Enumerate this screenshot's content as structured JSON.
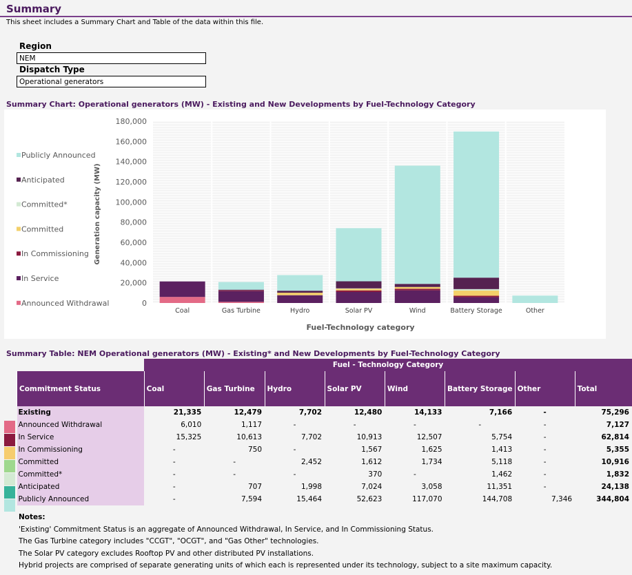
{
  "page": {
    "title": "Summary",
    "subtitle": "This sheet includes a Summary Chart and Table of the data within this file."
  },
  "filters": {
    "region_label": "Region",
    "region_value": "NEM",
    "dispatch_label": "Dispatch Type",
    "dispatch_value": "Operational generators"
  },
  "chart_section_title": "Summary Chart:  Operational generators (MW) - Existing and New Developments by Fuel-Technology Category",
  "table_section_title": "Summary Table:  NEM Operational generators (MW) - Existing* and New Developments by Fuel-Technology Category",
  "colors": {
    "Announced Withdrawal": "#e36a86",
    "In Service": "#5b2160",
    "In Commissioning": "#8b1a3f",
    "Committed": "#f3d06a",
    "Committed*": "#d3ead3",
    "Anticipated": "#552250",
    "Publicly Announced": "#b2e6e0"
  },
  "chart_data": {
    "type": "bar",
    "stacked": true,
    "categories": [
      "Coal",
      "Gas Turbine",
      "Hydro",
      "Solar PV",
      "Wind",
      "Battery Storage",
      "Other"
    ],
    "series": [
      {
        "name": "Announced Withdrawal",
        "values": [
          6010,
          1117,
          0,
          0,
          0,
          0,
          0
        ]
      },
      {
        "name": "In Service",
        "values": [
          15325,
          10613,
          7702,
          10913,
          12507,
          5754,
          0
        ]
      },
      {
        "name": "In Commissioning",
        "values": [
          0,
          750,
          0,
          1567,
          1625,
          1413,
          0
        ]
      },
      {
        "name": "Committed",
        "values": [
          0,
          0,
          2452,
          1612,
          1734,
          5118,
          0
        ]
      },
      {
        "name": "Committed*",
        "values": [
          0,
          0,
          0,
          370,
          0,
          1462,
          0
        ]
      },
      {
        "name": "Anticipated",
        "values": [
          0,
          707,
          1998,
          7024,
          3058,
          11351,
          0
        ]
      },
      {
        "name": "Publicly Announced",
        "values": [
          0,
          7594,
          15464,
          52623,
          117070,
          144708,
          7346
        ]
      }
    ],
    "legend_order": [
      "Publicly Announced",
      "Anticipated",
      "Committed*",
      "Committed",
      "In Commissioning",
      "In Service",
      "Announced Withdrawal"
    ],
    "xlabel": "Fuel-Technology category",
    "ylabel": "Generation capacity (MW)",
    "ylim": [
      0,
      180000
    ],
    "yticks": [
      "180,000",
      "160,000",
      "140,000",
      "120,000",
      "100,000",
      "80,000",
      "60,000",
      "40,000",
      "20,000",
      "0"
    ],
    "grid": true,
    "legend_position": "left"
  },
  "table": {
    "group_header": "Fuel - Technology Category",
    "columns": [
      "Commitment Status",
      "Coal",
      "Gas Turbine",
      "Hydro",
      "Solar PV",
      "Wind",
      "Battery Storage",
      "Other",
      "Total"
    ],
    "rows": [
      {
        "status": "Existing",
        "bold": true,
        "cells": [
          "21,335",
          "12,479",
          "7,702",
          "12,480",
          "14,133",
          "7,166",
          "-",
          "75,296"
        ]
      },
      {
        "status": "Announced Withdrawal",
        "color": "#e36a86",
        "cells": [
          "6,010",
          "1,117",
          "-",
          "-",
          "-",
          "-",
          "-",
          "7,127"
        ]
      },
      {
        "status": "In Service",
        "color": "#8b1a3f",
        "cells": [
          "15,325",
          "10,613",
          "7,702",
          "10,913",
          "12,507",
          "5,754",
          "-",
          "62,814"
        ]
      },
      {
        "status": "In Commissioning",
        "color": "#f6cd6e",
        "cells": [
          "-",
          "750",
          "-",
          "1,567",
          "1,625",
          "1,413",
          "-",
          "5,355"
        ]
      },
      {
        "status": "Committed",
        "color": "#9fd88e",
        "cells": [
          "-",
          "-",
          "2,452",
          "1,612",
          "1,734",
          "5,118",
          "-",
          "10,916"
        ]
      },
      {
        "status": "Committed*",
        "color": "#d3ead3",
        "cells": [
          "-",
          "-",
          "-",
          "370",
          "-",
          "1,462",
          "-",
          "1,832"
        ]
      },
      {
        "status": "Anticipated",
        "color": "#37b39a",
        "cells": [
          "-",
          "707",
          "1,998",
          "7,024",
          "3,058",
          "11,351",
          "-",
          "24,138"
        ]
      },
      {
        "status": "Publicly Announced",
        "color": "#b2e6e0",
        "cells": [
          "-",
          "7,594",
          "15,464",
          "52,623",
          "117,070",
          "144,708",
          "7,346",
          "344,804"
        ]
      }
    ]
  },
  "notes": {
    "title": "Notes:",
    "lines": [
      "'Existing' Commitment Status is an aggregate of Announced Withdrawal, In Service, and In Commissioning Status.",
      "The Gas Turbine category includes \"CCGT\", \"OCGT\", and \"Gas Other\" technologies.",
      "The Solar PV category excludes Rooftop PV and other distributed PV installations.",
      "Hybrid projects are comprised of separate generating units of which each is represented under its technology, subject to a site maximum capacity."
    ]
  }
}
